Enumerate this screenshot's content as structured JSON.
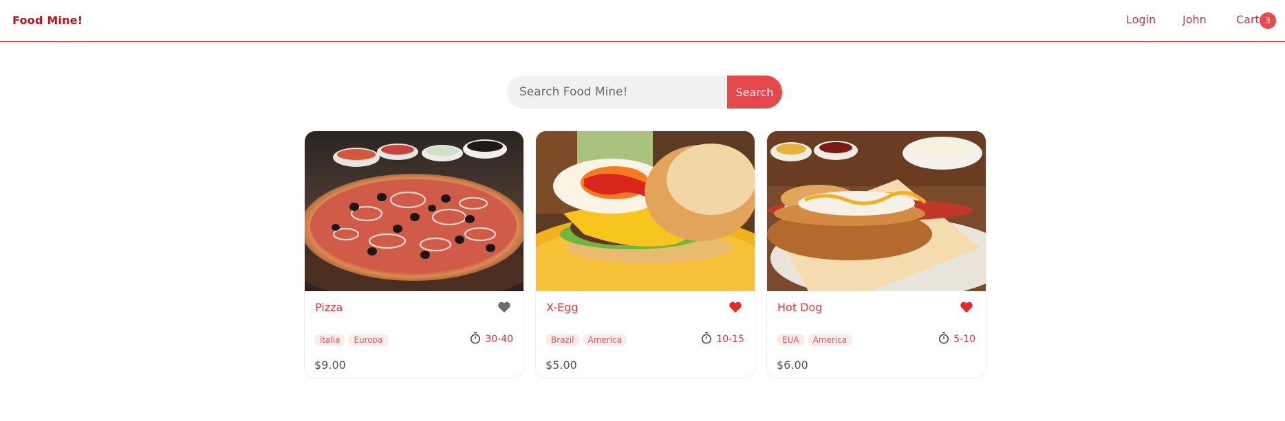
{
  "header": {
    "brand": "Food Mine!",
    "nav": {
      "login": "Login",
      "user": "John",
      "cart": "Cart",
      "cart_count": "3"
    }
  },
  "search": {
    "placeholder": "Search Food Mine!",
    "button": "Search"
  },
  "foods": [
    {
      "name": "Pizza",
      "favorite": false,
      "tags": [
        "italia",
        "Europa"
      ],
      "cook_time": "30-40",
      "price": "$9.00"
    },
    {
      "name": "X-Egg",
      "favorite": true,
      "tags": [
        "Brazil",
        "America"
      ],
      "cook_time": "10-15",
      "price": "$5.00"
    },
    {
      "name": "Hot Dog",
      "favorite": true,
      "tags": [
        "EUA",
        "America"
      ],
      "cook_time": "5-10",
      "price": "$6.00"
    }
  ],
  "colors": {
    "accent": "#e6474b",
    "favorite_on": "#e72929",
    "favorite_off": "#6d6d6d"
  }
}
